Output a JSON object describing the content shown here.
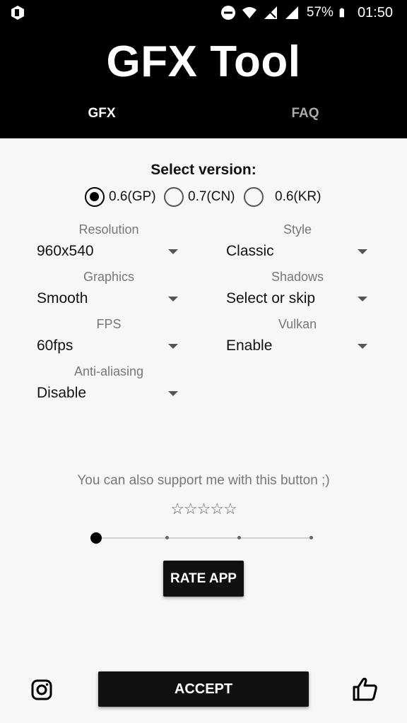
{
  "status_bar": {
    "battery_percent": "57%",
    "time": "01:50",
    "icons": [
      "app-badge-icon",
      "do-not-disturb-icon",
      "wifi-icon",
      "signal-no-sim-icon",
      "signal-icon",
      "battery-icon"
    ]
  },
  "header": {
    "title": "GFX Tool",
    "tabs": [
      {
        "label": "GFX",
        "active": true
      },
      {
        "label": "FAQ",
        "active": false
      }
    ]
  },
  "version": {
    "title": "Select version:",
    "options": [
      {
        "label": "0.6(GP)",
        "selected": true
      },
      {
        "label": "0.7(CN)",
        "selected": false
      },
      {
        "label": "0.6(KR)",
        "selected": false
      }
    ]
  },
  "settings": {
    "resolution": {
      "label": "Resolution",
      "value": "960x540"
    },
    "style": {
      "label": "Style",
      "value": "Classic"
    },
    "graphics": {
      "label": "Graphics",
      "value": "Smooth"
    },
    "shadows": {
      "label": "Shadows",
      "value": "Select or skip"
    },
    "fps": {
      "label": "FPS",
      "value": "60fps"
    },
    "vulkan": {
      "label": "Vulkan",
      "value": "Enable"
    },
    "antialiasing": {
      "label": "Anti-aliasing",
      "value": "Disable"
    }
  },
  "support": {
    "text": "You can also support me with this button ;)",
    "stars": "☆☆☆☆☆",
    "rating_value": 0,
    "rating_max": 5,
    "slider_position": 0,
    "rate_button": "RATE APP"
  },
  "footer": {
    "accept_button": "ACCEPT",
    "left_icon": "instagram-icon",
    "right_icon": "thumbs-up-icon"
  },
  "colors": {
    "header_bg": "#000000",
    "body_bg": "#f7f7f7",
    "button_bg": "#111111",
    "inactive_tab": "#aaaaaa",
    "label_gray": "#777777"
  }
}
